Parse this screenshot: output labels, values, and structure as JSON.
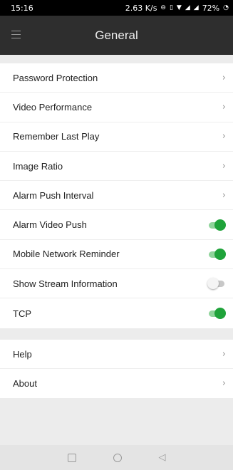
{
  "status_bar": {
    "time": "15:16",
    "speed": "2.63 K/s",
    "battery": "72%",
    "icons": [
      "do-not-disturb-icon",
      "vibrate-icon",
      "wifi-icon",
      "signal-icon",
      "signal-icon",
      "battery-icon"
    ]
  },
  "app_bar": {
    "title": "General",
    "menu_icon": "hamburger-menu-icon"
  },
  "settings": {
    "items": [
      {
        "label": "Password Protection",
        "control": "chevron"
      },
      {
        "label": "Video Performance",
        "control": "chevron"
      },
      {
        "label": "Remember Last Play",
        "control": "chevron"
      },
      {
        "label": "Image Ratio",
        "control": "chevron"
      },
      {
        "label": "Alarm Push Interval",
        "control": "chevron"
      },
      {
        "label": "Alarm Video Push",
        "control": "toggle",
        "enabled": true
      },
      {
        "label": "Mobile Network Reminder",
        "control": "toggle",
        "enabled": true
      },
      {
        "label": "Show Stream Information",
        "control": "toggle",
        "enabled": false
      },
      {
        "label": "TCP",
        "control": "toggle",
        "enabled": true
      }
    ]
  },
  "more": {
    "items": [
      {
        "label": "Help",
        "control": "chevron"
      },
      {
        "label": "About",
        "control": "chevron"
      }
    ]
  },
  "glyphs": {
    "chevron": "›",
    "back": "◁"
  },
  "colors": {
    "app_bar": "#2e2e2e",
    "toggle_on": "#1fa33a",
    "toggle_off": "#c8c8c8",
    "background": "#ececec"
  },
  "nav_bar": {
    "buttons": [
      "recents-square-icon",
      "home-circle-icon",
      "back-triangle-icon"
    ]
  }
}
